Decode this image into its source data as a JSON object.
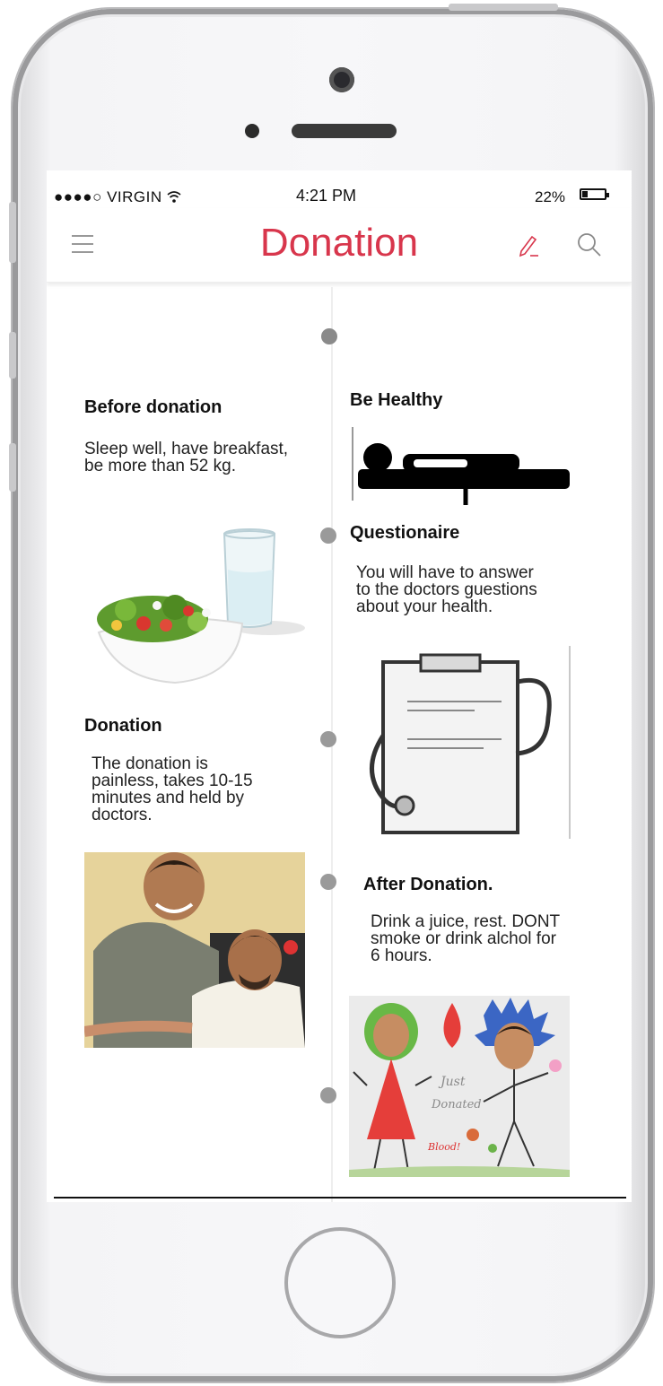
{
  "status_bar": {
    "carrier": "●●●●○ VIRGIN",
    "time": "4:21 PM",
    "battery": "22%"
  },
  "nav": {
    "title": "Donation",
    "title_color": "#d8364c"
  },
  "timeline": {
    "left_items": [
      {
        "title": "Before donation",
        "text": "Sleep well, have breakfast, be more than 52 kg.",
        "image": "salad-and-water-image"
      },
      {
        "title": "Donation",
        "text": "The donation is painless, takes 10-15 minutes and held by doctors.",
        "image": "donor-photo"
      }
    ],
    "right_items": [
      {
        "title": "Be Healthy",
        "image": "person-lying-icon"
      },
      {
        "title": "Questionaire",
        "text": "You will have to answer to the doctors guestions about your health.",
        "image": "clipboard-stethoscope-image"
      },
      {
        "title": "After Donation.",
        "text": "Drink a juice, rest. DONT smoke or drink alchol for 6 hours.",
        "image": "just-donated-drawing"
      }
    ]
  },
  "drawing_text": {
    "line1": "Just",
    "line2": "Donated",
    "line3": "Blood!"
  }
}
